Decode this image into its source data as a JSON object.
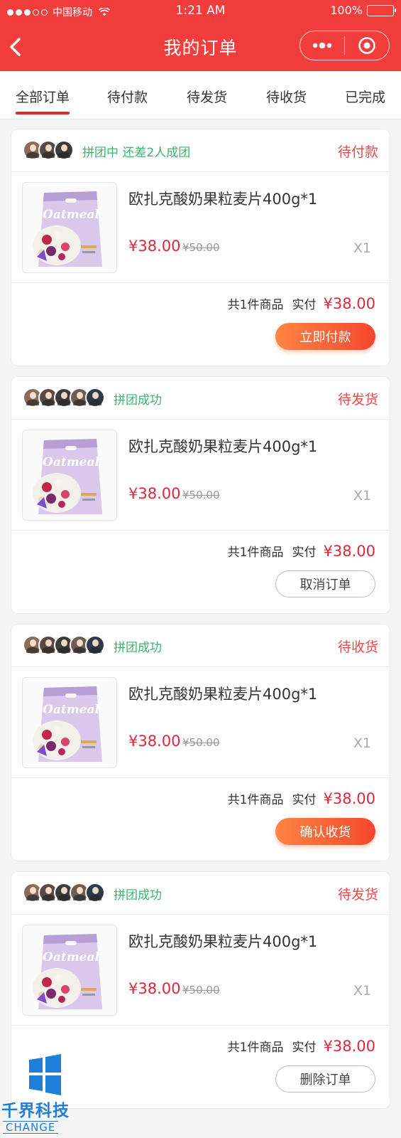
{
  "status_bar": {
    "carrier": "中国移动",
    "time": "1:21 AM",
    "battery": "100%"
  },
  "nav": {
    "title": "我的订单",
    "back_icon": "chevron-left-icon",
    "menu_icon": "more-dots-icon",
    "close_icon": "target-close-icon"
  },
  "tabs": [
    {
      "label": "全部订单",
      "active": true
    },
    {
      "label": "待付款",
      "active": false
    },
    {
      "label": "待发货",
      "active": false
    },
    {
      "label": "待收货",
      "active": false
    },
    {
      "label": "已完成",
      "active": false
    }
  ],
  "orders": [
    {
      "group_status": "拼团中 还差2人成团",
      "avatar_count": 3,
      "order_status": "待付款",
      "product_name": "欧扎克酸奶果粒麦片400g*1",
      "price": "¥38.00",
      "original_price": "¥50.00",
      "quantity": "X1",
      "item_count": "共1件商品",
      "paid_label": "实付",
      "total": "¥38.00",
      "action": "立即付款",
      "action_style": "primary"
    },
    {
      "group_status": "拼团成功",
      "avatar_count": 5,
      "order_status": "待发货",
      "product_name": "欧扎克酸奶果粒麦片400g*1",
      "price": "¥38.00",
      "original_price": "¥50.00",
      "quantity": "X1",
      "item_count": "共1件商品",
      "paid_label": "实付",
      "total": "¥38.00",
      "action": "取消订单",
      "action_style": "ghost"
    },
    {
      "group_status": "拼团成功",
      "avatar_count": 5,
      "order_status": "待收货",
      "product_name": "欧扎克酸奶果粒麦片400g*1",
      "price": "¥38.00",
      "original_price": "¥50.00",
      "quantity": "X1",
      "item_count": "共1件商品",
      "paid_label": "实付",
      "total": "¥38.00",
      "action": "确认收货",
      "action_style": "primary"
    },
    {
      "group_status": "拼团成功",
      "avatar_count": 5,
      "order_status": "待发货",
      "product_name": "欧扎克酸奶果粒麦片400g*1",
      "price": "¥38.00",
      "original_price": "¥50.00",
      "quantity": "X1",
      "item_count": "共1件商品",
      "paid_label": "实付",
      "total": "¥38.00",
      "action": "删除订单",
      "action_style": "ghost"
    }
  ],
  "product_image_text": "Oatmeal",
  "watermark": {
    "name": "千界科技",
    "sub": "CHANGE"
  },
  "colors": {
    "brand_red": "#f23d3d",
    "price_red": "#e0263a",
    "group_green": "#3cb46e",
    "button_orange": "#ff8542"
  }
}
